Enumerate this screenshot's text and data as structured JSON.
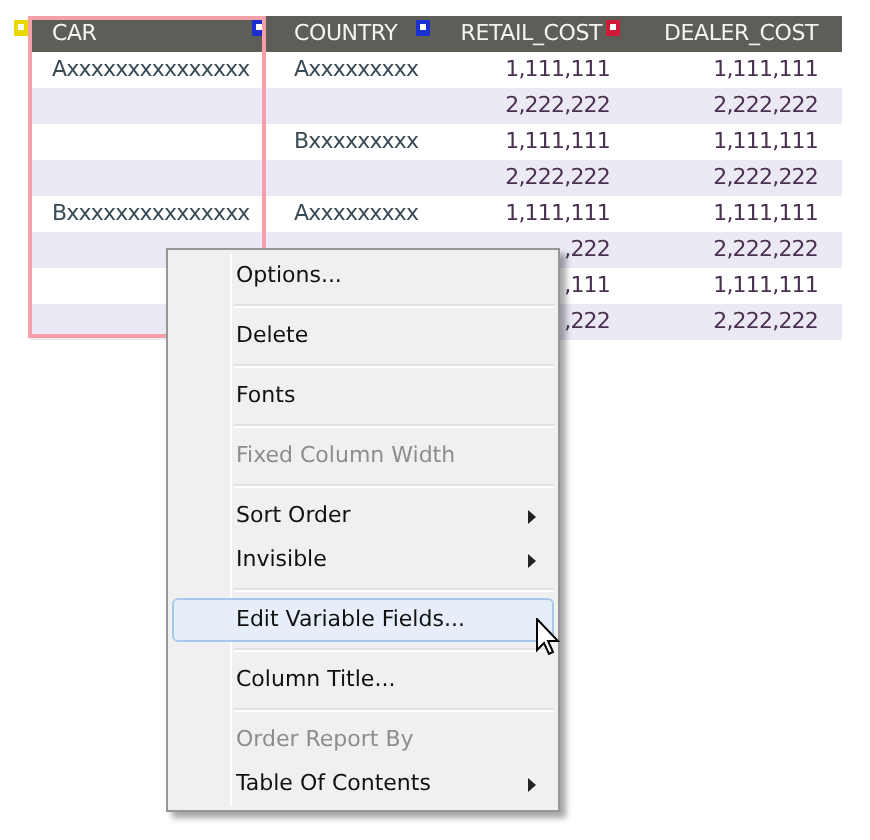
{
  "table": {
    "corner_icon": {
      "color": "#e8d800"
    },
    "columns": [
      {
        "label": "CAR",
        "color": "#1a2fd0",
        "selected": true
      },
      {
        "label": "COUNTRY",
        "color": "#1a2fd0",
        "selected": false
      },
      {
        "label": "RETAIL_COST",
        "color": "#d01a3a",
        "selected": false
      },
      {
        "label": "DEALER_COST",
        "selected": false
      }
    ],
    "rows": [
      [
        "Axxxxxxxxxxxxxxx",
        "Axxxxxxxxx",
        "1,111,111",
        "1,111,111"
      ],
      [
        "",
        "",
        "2,222,222",
        "2,222,222"
      ],
      [
        "",
        "Bxxxxxxxxx",
        "1,111,111",
        "1,111,111"
      ],
      [
        "",
        "",
        "2,222,222",
        "2,222,222"
      ],
      [
        "Bxxxxxxxxxxxxxxx",
        "Axxxxxxxxx",
        "1,111,111",
        "1,111,111"
      ],
      [
        "",
        "",
        ",222",
        "2,222,222"
      ],
      [
        "",
        "",
        ",111",
        "1,111,111"
      ],
      [
        "",
        "",
        ",222",
        "2,222,222"
      ]
    ]
  },
  "context_menu": {
    "items": [
      {
        "kind": "item",
        "label": "Options...",
        "disabled": false,
        "submenu": false,
        "selected": false
      },
      {
        "kind": "separator"
      },
      {
        "kind": "item",
        "label": "Delete",
        "disabled": false,
        "submenu": false,
        "selected": false
      },
      {
        "kind": "separator"
      },
      {
        "kind": "item",
        "label": "Fonts",
        "disabled": false,
        "submenu": false,
        "selected": false
      },
      {
        "kind": "separator"
      },
      {
        "kind": "item",
        "label": "Fixed Column Width",
        "disabled": true,
        "submenu": false,
        "selected": false
      },
      {
        "kind": "separator"
      },
      {
        "kind": "item",
        "label": "Sort Order",
        "disabled": false,
        "submenu": true,
        "selected": false
      },
      {
        "kind": "item",
        "label": "Invisible",
        "disabled": false,
        "submenu": true,
        "selected": false
      },
      {
        "kind": "separator"
      },
      {
        "kind": "item",
        "label": "Edit Variable Fields...",
        "disabled": false,
        "submenu": false,
        "selected": true
      },
      {
        "kind": "separator"
      },
      {
        "kind": "item",
        "label": "Column Title...",
        "disabled": false,
        "submenu": false,
        "selected": false
      },
      {
        "kind": "separator"
      },
      {
        "kind": "item",
        "label": "Order Report By",
        "disabled": true,
        "submenu": false,
        "selected": false
      },
      {
        "kind": "item",
        "label": "Table Of Contents",
        "disabled": false,
        "submenu": true,
        "selected": false
      }
    ]
  }
}
